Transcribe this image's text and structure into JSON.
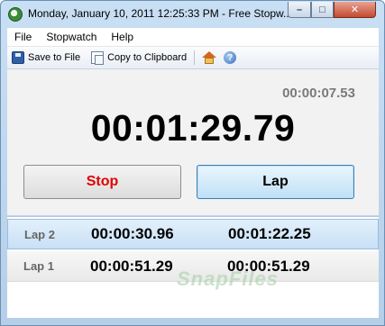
{
  "window": {
    "title": "Monday, January 10, 2011 12:25:33 PM - Free Stopw...",
    "minimize_label": "–",
    "maximize_label": "□",
    "close_label": "✕"
  },
  "menu": {
    "items": [
      "File",
      "Stopwatch",
      "Help"
    ]
  },
  "toolbar": {
    "save_label": "Save to File",
    "copy_label": "Copy to Clipboard",
    "home_icon": "home-icon",
    "help_icon": "help-icon"
  },
  "display": {
    "lap_time": "00:00:07.53",
    "total_time": "00:01:29.79"
  },
  "buttons": {
    "stop_label": "Stop",
    "lap_label": "Lap"
  },
  "laps": [
    {
      "name": "Lap 2",
      "split": "00:00:30.96",
      "total": "00:01:22.25",
      "selected": true
    },
    {
      "name": "Lap 1",
      "split": "00:00:51.29",
      "total": "00:00:51.29",
      "selected": false
    }
  ],
  "watermark": "SnapFiles",
  "colors": {
    "stop_text": "#e00000",
    "accent_blue": "#3c7fb1"
  }
}
